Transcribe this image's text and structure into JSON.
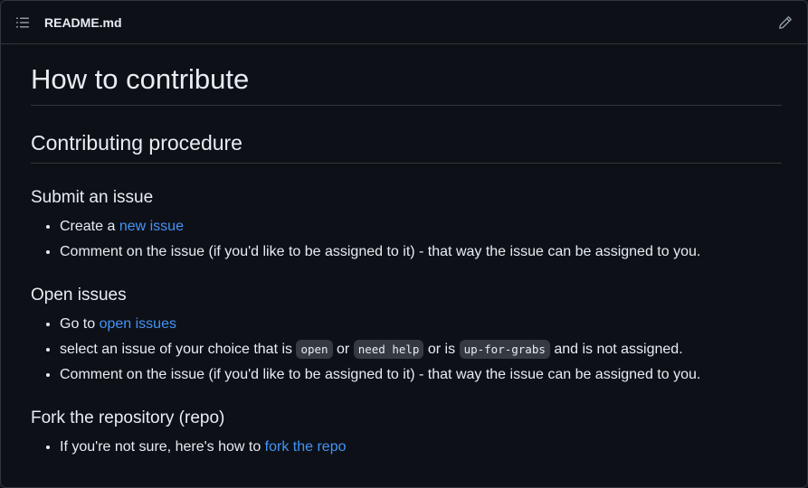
{
  "header": {
    "filename": "README.md",
    "toc_icon": "list-unordered-icon",
    "edit_icon": "pencil-icon"
  },
  "doc": {
    "h1": "How to contribute",
    "h2": "Contributing procedure",
    "s1": {
      "title": "Submit an issue",
      "li1_pre": "Create a ",
      "li1_link": "new issue",
      "li2": "Comment on the issue (if you'd like to be assigned to it) - that way the issue can be assigned to you."
    },
    "s2": {
      "title": "Open issues",
      "li1_pre": "Go to ",
      "li1_link": "open issues",
      "li2_a": "select an issue of your choice that is ",
      "code1": "open",
      "li2_b": " or ",
      "code2": "need help",
      "li2_c": " or is ",
      "code3": "up-for-grabs",
      "li2_d": " and is not assigned.",
      "li3": "Comment on the issue (if you'd like to be assigned to it) - that way the issue can be assigned to you."
    },
    "s3": {
      "title": "Fork the repository (repo)",
      "li1_pre": "If you're not sure, here's how to ",
      "li1_link": "fork the repo"
    }
  }
}
